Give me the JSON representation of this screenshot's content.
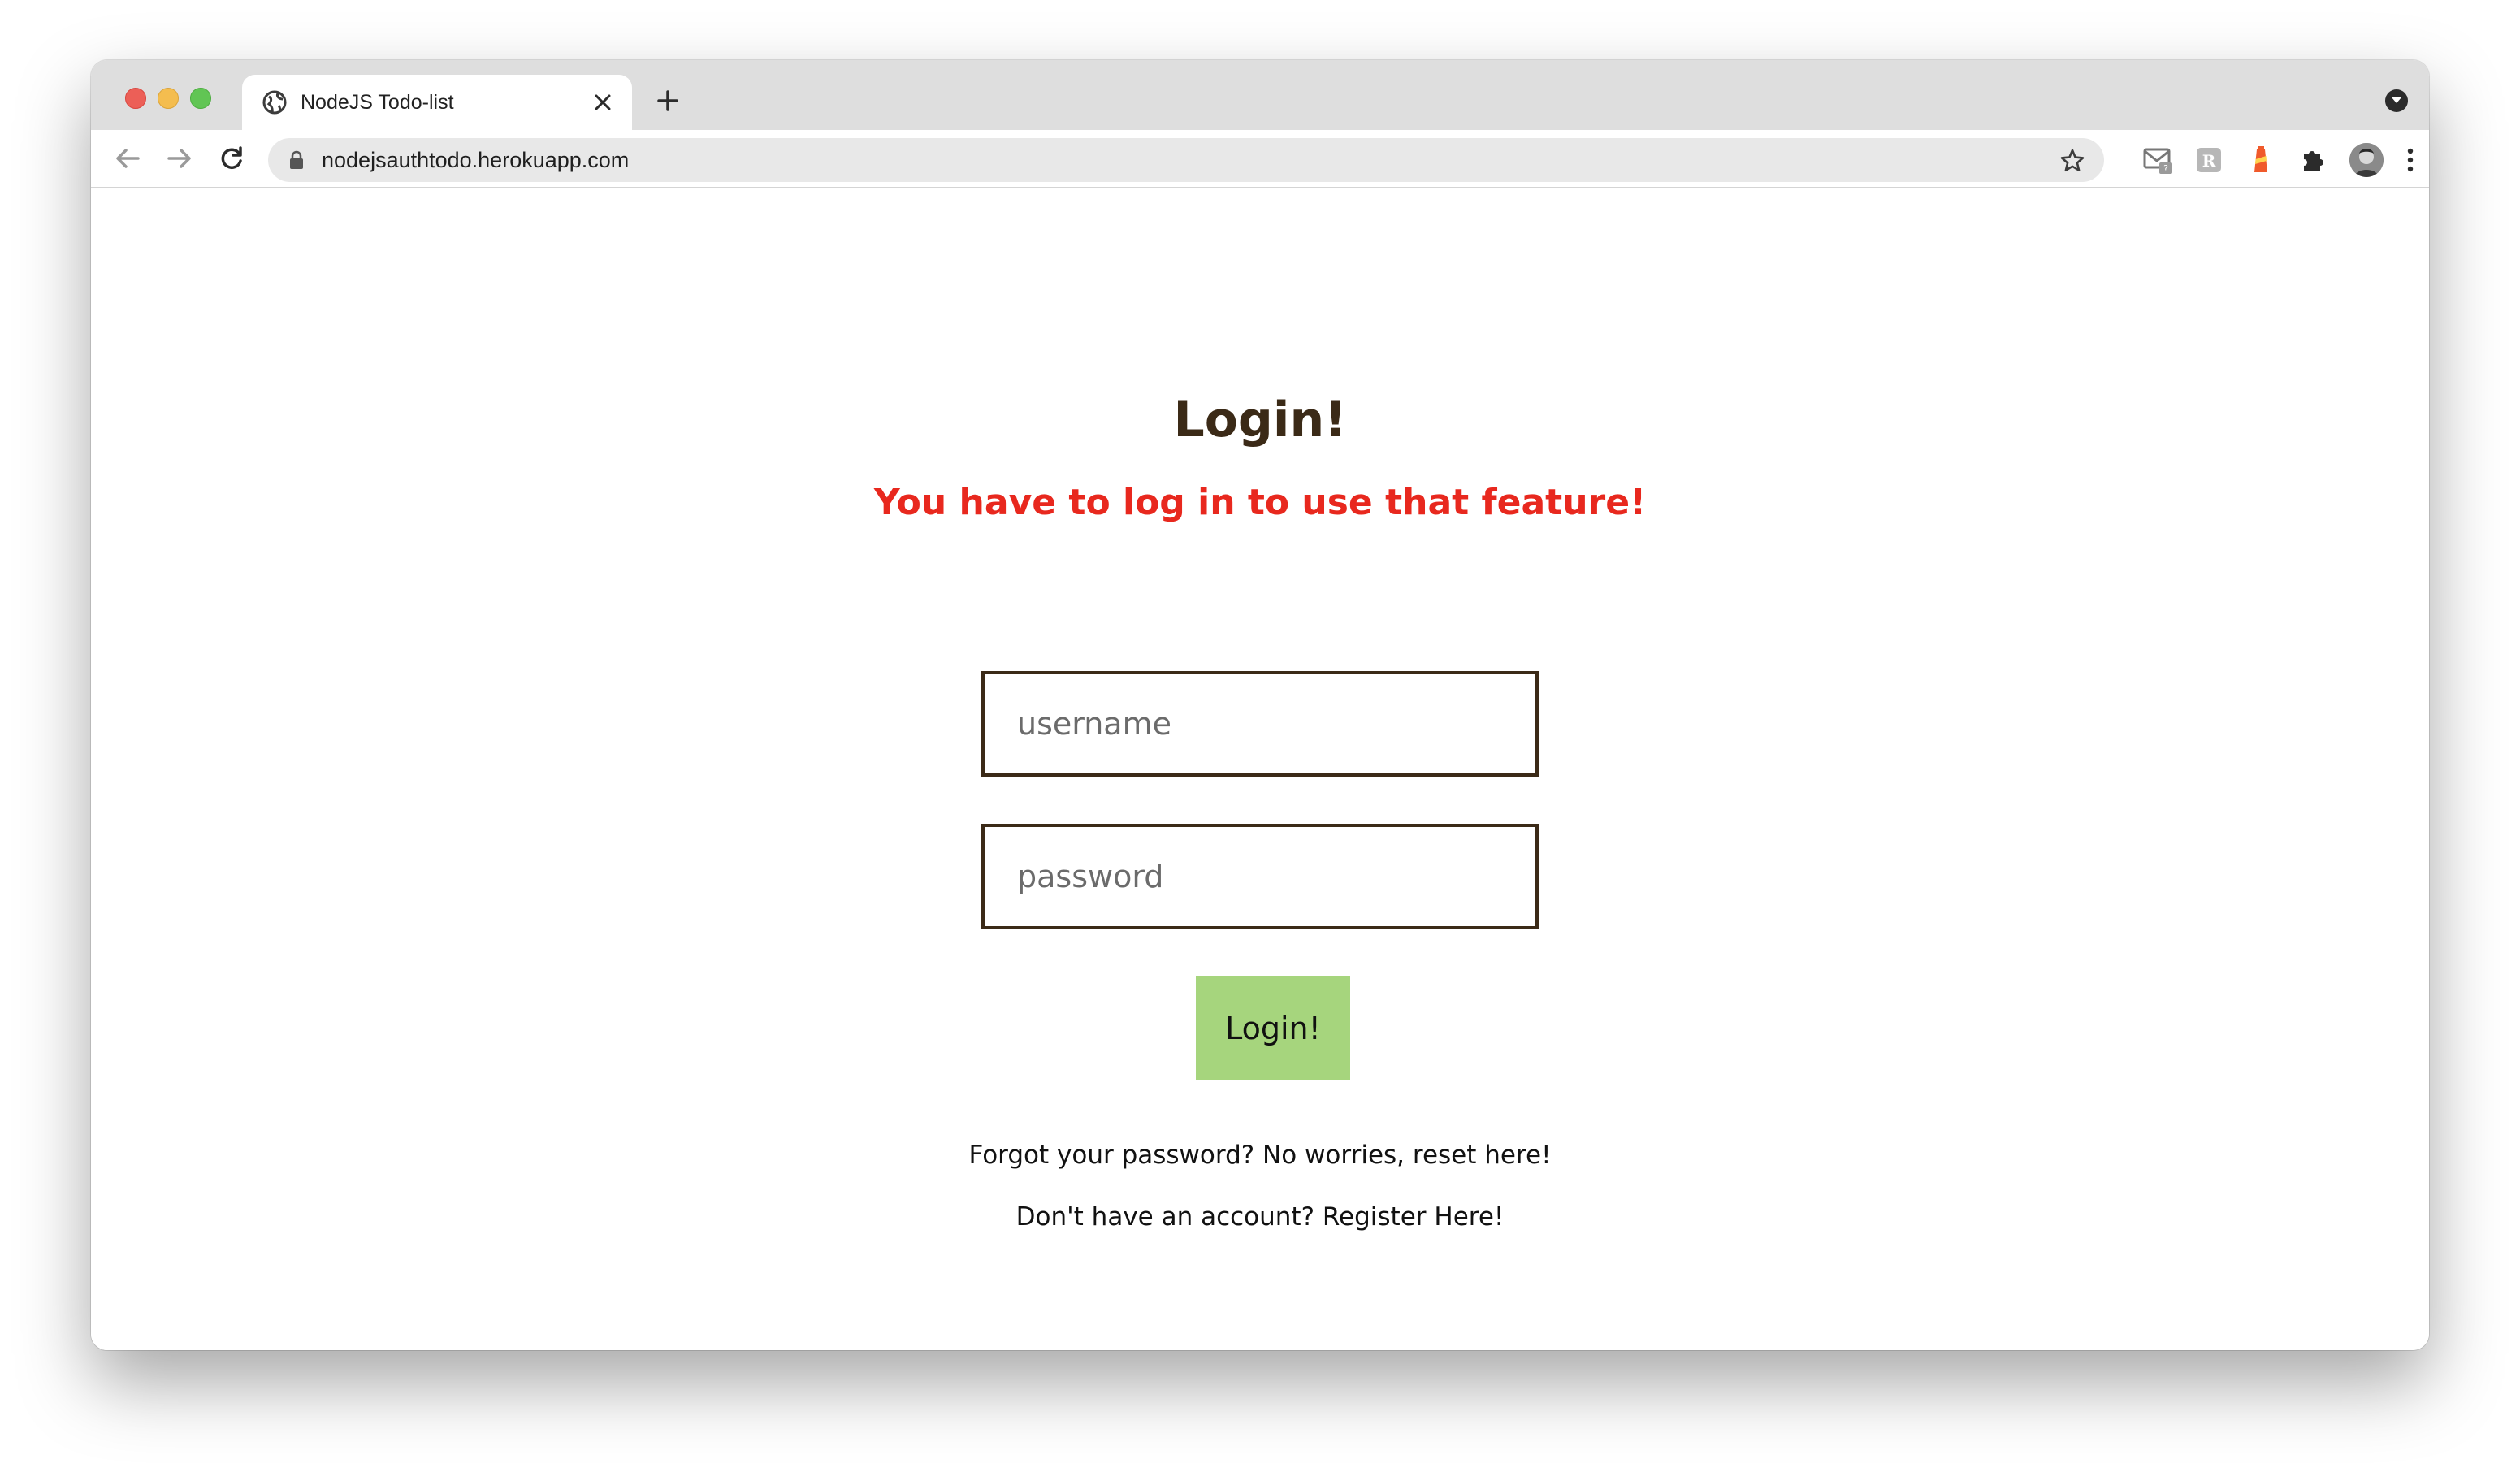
{
  "browser": {
    "tab": {
      "title": "NodeJS Todo-list"
    },
    "address_bar": {
      "url": "nodejsauthtodo.herokuapp.com"
    },
    "icons": {
      "tab_favicon": "globe-icon",
      "tab_close": "close-icon",
      "new_tab": "plus-icon",
      "back": "arrow-left-icon",
      "forward": "arrow-right-icon",
      "reload": "reload-icon",
      "lock": "lock-icon",
      "bookmark": "star-icon",
      "extensions": [
        "gmail-checker-icon",
        "r-extension-icon",
        "lighthouse-icon",
        "puzzle-icon"
      ],
      "profile": "avatar",
      "menu": "kebab-menu-icon"
    }
  },
  "page": {
    "title": "Login!",
    "alert": "You have to log in to use that feature!",
    "username": {
      "placeholder": "username",
      "value": ""
    },
    "password": {
      "placeholder": "password",
      "value": ""
    },
    "submit_label": "Login!",
    "forgot_text": "Forgot your password? No worries, reset here!",
    "register_text": "Don't have an account? Register Here!"
  },
  "colors": {
    "heading": "#3b2a17",
    "alert": "#e8281e",
    "button": "#a6d57d",
    "input_border": "#3b2a17"
  }
}
